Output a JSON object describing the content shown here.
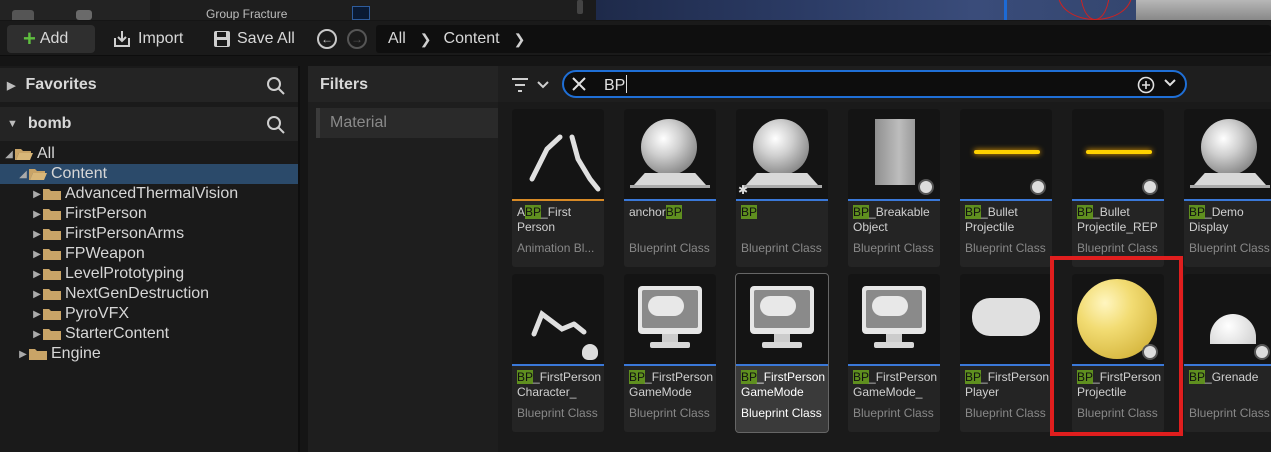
{
  "top_panel": {
    "label": "Group Fracture"
  },
  "toolbar": {
    "add_label": "Add",
    "import_label": "Import",
    "save_all_label": "Save All"
  },
  "breadcrumb": [
    "All",
    "Content"
  ],
  "left": {
    "favorites_label": "Favorites",
    "project_label": "bomb",
    "tree": [
      {
        "label": "All",
        "depth": 0,
        "expanded": true
      },
      {
        "label": "Content",
        "depth": 1,
        "expanded": true,
        "selected": true
      },
      {
        "label": "AdvancedThermalVision",
        "depth": 2
      },
      {
        "label": "FirstPerson",
        "depth": 2
      },
      {
        "label": "FirstPersonArms",
        "depth": 2
      },
      {
        "label": "FPWeapon",
        "depth": 2
      },
      {
        "label": "LevelPrototyping",
        "depth": 2
      },
      {
        "label": "NextGenDestruction",
        "depth": 2
      },
      {
        "label": "PyroVFX",
        "depth": 2
      },
      {
        "label": "StarterContent",
        "depth": 2
      },
      {
        "label": "Engine",
        "depth": 1
      }
    ]
  },
  "filters": {
    "title": "Filters",
    "items": [
      "Material"
    ]
  },
  "search": {
    "value": "BP"
  },
  "assets": [
    {
      "pre": "A",
      "hl": "BP",
      "post": "_First\nPerson",
      "type": "Animation Bl...",
      "thumb": "arm"
    },
    {
      "pre": "anchor",
      "hl": "BP",
      "post": "",
      "type": "Blueprint Class",
      "thumb": "sphere"
    },
    {
      "pre": "",
      "hl": "BP",
      "post": "",
      "type": "Blueprint Class",
      "thumb": "sphere-star"
    },
    {
      "pre": "",
      "hl": "BP",
      "post": "_Breakable\nObject",
      "type": "Blueprint Class",
      "thumb": "box"
    },
    {
      "pre": "",
      "hl": "BP",
      "post": "_Bullet\nProjectile",
      "type": "Blueprint Class",
      "thumb": "laser"
    },
    {
      "pre": "",
      "hl": "BP",
      "post": "_Bullet\nProjectile_REP",
      "type": "Blueprint Class",
      "thumb": "laser"
    },
    {
      "pre": "",
      "hl": "BP",
      "post": "_Demo\nDisplay",
      "type": "Blueprint Class",
      "thumb": "sphere"
    },
    {
      "pre": "",
      "hl": "BP",
      "post": "_FirstPerson\nCharacter_",
      "type": "Blueprint Class",
      "thumb": "arm2"
    },
    {
      "pre": "",
      "hl": "BP",
      "post": "_FirstPerson\nGameMode",
      "type": "Blueprint Class",
      "thumb": "monitor"
    },
    {
      "pre": "",
      "hl": "BP",
      "post": "_FirstPerson\nGameMode",
      "type": "Blueprint Class",
      "thumb": "monitor",
      "selected": true
    },
    {
      "pre": "",
      "hl": "BP",
      "post": "_FirstPerson\nGameMode_",
      "type": "Blueprint Class",
      "thumb": "monitor"
    },
    {
      "pre": "",
      "hl": "BP",
      "post": "_FirstPerson\nPlayer",
      "type": "Blueprint Class",
      "thumb": "gamepad"
    },
    {
      "pre": "",
      "hl": "BP",
      "post": "_FirstPerson\nProjectile",
      "type": "Blueprint Class",
      "thumb": "yellow"
    },
    {
      "pre": "",
      "hl": "BP",
      "post": "_Grenade",
      "type": "Blueprint Class",
      "thumb": "dome"
    }
  ],
  "colors": {
    "accent_blue": "#1f6fd6",
    "highlight_green": "#5f8f1f",
    "annotation_red": "#e01e1e"
  }
}
